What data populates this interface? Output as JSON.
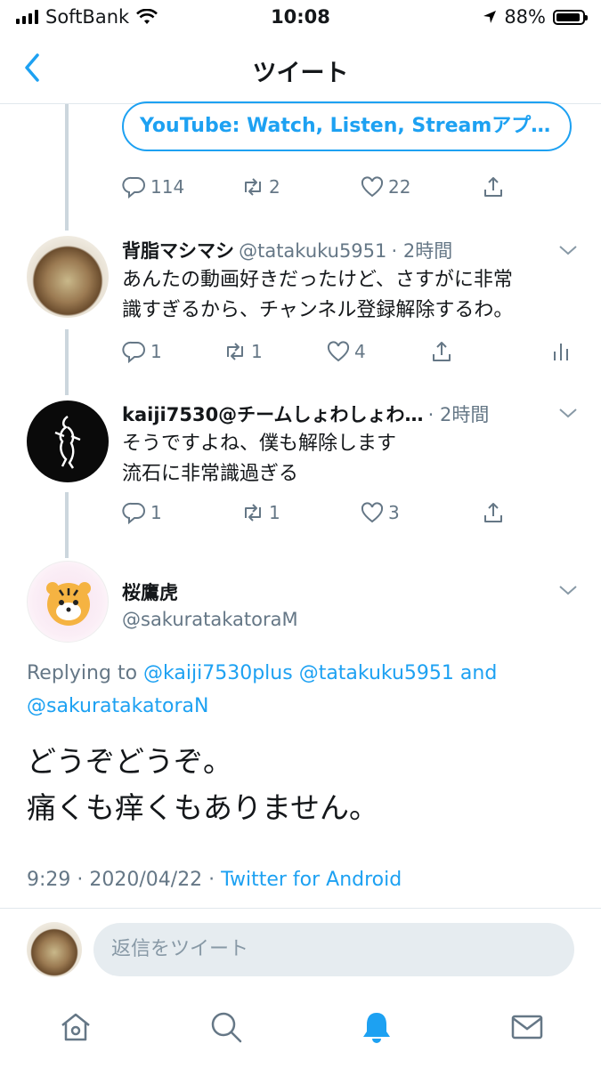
{
  "status": {
    "carrier": "SoftBank",
    "time": "10:08",
    "battery": "88%"
  },
  "nav": {
    "title": "ツイート"
  },
  "link_card": {
    "text": "YouTube: Watch, Listen, Streamアプ…"
  },
  "main_actions": {
    "replies": "114",
    "retweets": "2",
    "likes": "22"
  },
  "replies": [
    {
      "name": "背脂マシマシ",
      "handle": "@tatakuku5951",
      "time": "· 2時間",
      "lines": [
        "あんたの動画好きだったけど、さすがに非常",
        "識すぎるから、チャンネル登録解除するわ。"
      ],
      "replies": "1",
      "retweets": "1",
      "likes": "4"
    },
    {
      "name": "kaiji7530@チームしょわしょわ…",
      "handle": "",
      "time": "· 2時間",
      "lines": [
        "そうですよね、僕も解除します",
        "流石に非常識過ぎる"
      ],
      "replies": "1",
      "retweets": "1",
      "likes": "3"
    }
  ],
  "focused": {
    "name": "桜鷹虎",
    "handle": "@sakuratakatoraM",
    "replying_prefix": "Replying to",
    "reply_to_1": "@kaiji7530plus",
    "reply_to_2": "@tatakuku5951",
    "and": "and",
    "reply_to_3": "@sakuratakatoraN",
    "lines": [
      "どうぞどうぞ。",
      "痛くも痒くもありません。"
    ],
    "timestamp": "9:29 · 2020/04/22 ·",
    "source": "Twitter for Android"
  },
  "reply_box": {
    "placeholder": "返信をツイート"
  },
  "colors": {
    "accent": "#1da1f2",
    "muted": "#657786"
  },
  "icons": [
    "back-chevron-icon",
    "reply-icon",
    "retweet-icon",
    "like-icon",
    "share-icon",
    "analytics-icon",
    "home-icon",
    "search-icon",
    "notifications-icon",
    "messages-icon"
  ]
}
